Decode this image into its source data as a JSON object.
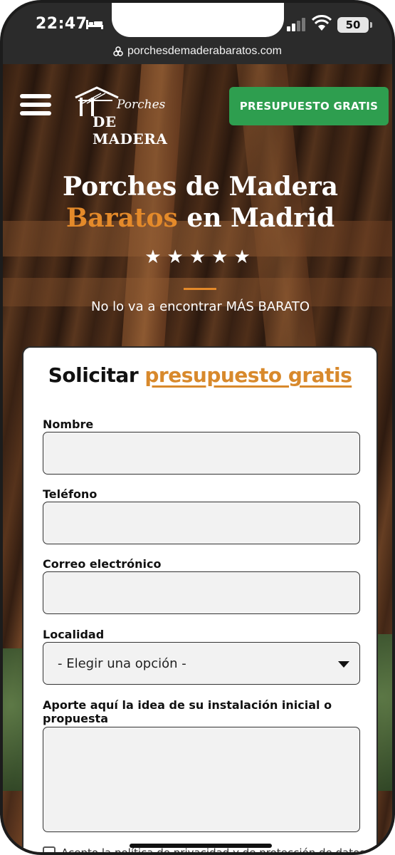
{
  "status_bar": {
    "time": "22:47",
    "battery": "50"
  },
  "browser": {
    "url": "porchesdemaderabaratos.com"
  },
  "header": {
    "logo_line1": "Porches",
    "logo_line2": "DE MADERA",
    "cta_label": "PRESUPUESTO GRATIS"
  },
  "hero": {
    "title_line1": "Porches de Madera",
    "title_accent": "Baratos",
    "title_rest": " en Madrid",
    "stars": "★★★★★",
    "tagline": "No lo va a encontrar MÁS BARATO"
  },
  "form": {
    "title_prefix": "Solicitar ",
    "title_link": "presupuesto gratis",
    "fields": {
      "name_label": "Nombre",
      "phone_label": "Teléfono",
      "email_label": "Correo electrónico",
      "locality_label": "Localidad",
      "locality_value": "- Elegir una opción -",
      "idea_label": "Aporte aquí la idea de su instalación inicial o propuesta"
    },
    "privacy_text": "Acepto la política de privacidad y de protección de datos"
  },
  "colors": {
    "accent": "#e48a2a",
    "cta_green": "#2e9e4f",
    "link": "#d8892c"
  }
}
